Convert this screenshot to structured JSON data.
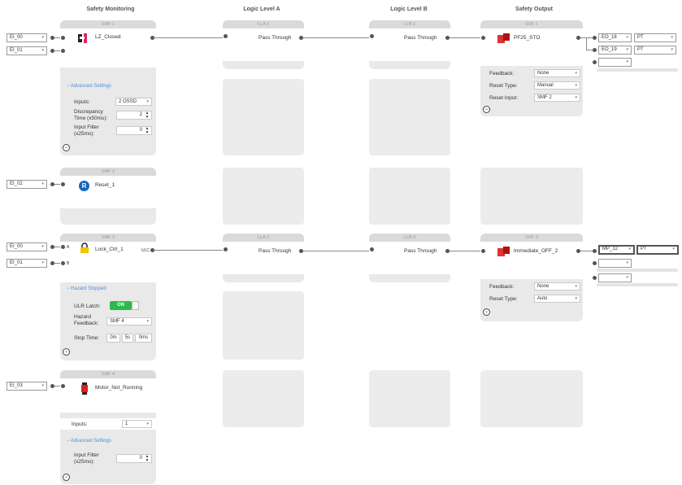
{
  "columns": [
    "Safety Monitoring",
    "Logic Level A",
    "Logic Level B",
    "Safety Output"
  ],
  "inputs": {
    "ei00": "EI_00",
    "ei01": "EI_01",
    "ei02": "EI_02",
    "ei00b": "EI_00",
    "ei01b": "EI_01",
    "ei03": "EI_03"
  },
  "smf1": {
    "header": "SMF 1",
    "name": "LZ_Closed",
    "advanced": "Advanced Settings",
    "inputs_label": "Inputs:",
    "inputs_value": "2 OSSD",
    "discrepancy_label": "Discrepancy Time (x50ms):",
    "discrepancy_value": "2",
    "filter_label": "Input Filter (x25ms):",
    "filter_value": "0"
  },
  "smf2": {
    "header": "SMF 2",
    "name": "Reset_1"
  },
  "smf3": {
    "header": "SMF 3",
    "name": "Lock_Ctrl_1",
    "out_label": "ULC",
    "pin_a": "A",
    "pin_b": "B",
    "hazard": "Hazard Stopped",
    "ulr_label": "ULR Latch:",
    "ulr_value": "ON",
    "hazard_feedback_label": "Hazard Feedback:",
    "hazard_feedback_value": "SMF 4",
    "stop_time_label": "Stop Time:",
    "stop_m": "0m",
    "stop_s": "5s",
    "stop_ms": "0ms"
  },
  "smf4": {
    "header": "SMF 4",
    "name": "Motor_Not_Running",
    "inputs_label": "Inputs:",
    "inputs_value": "1",
    "advanced": "Advanced Settings",
    "filter_label": "Input Filter (x25ms):",
    "filter_value": "0"
  },
  "lla1": {
    "header": "LLA 1",
    "text": "Pass Through"
  },
  "llb1": {
    "header": "LLB 1",
    "text": "Pass Through"
  },
  "lla3": {
    "header": "LLA 3",
    "text": "Pass Through"
  },
  "llb3": {
    "header": "LLB 3",
    "text": "Pass Through"
  },
  "sof1": {
    "header": "SOF 1",
    "name": "PF25_STO",
    "feedback_label": "Feedback:",
    "feedback_value": "None",
    "reset_type_label": "Reset Type:",
    "reset_type_value": "Manual",
    "reset_input_label": "Reset Input:",
    "reset_input_value": "SMF 2"
  },
  "sof3": {
    "header": "SOF 3",
    "name": "Immediate_OFF_2",
    "feedback_label": "Feedback:",
    "feedback_value": "None",
    "reset_type_label": "Reset Type:",
    "reset_type_value": "Auto"
  },
  "outputs": {
    "eo18": "EO_18",
    "eo18_type": "PT",
    "eo19": "EO_19",
    "eo19_type": "PT",
    "mp12": "MP_12",
    "mp12_type": "PT"
  },
  "icons": {
    "chevron": "⌄",
    "caret": "▾",
    "up": "▲",
    "down": "▼",
    "minus": "−"
  }
}
